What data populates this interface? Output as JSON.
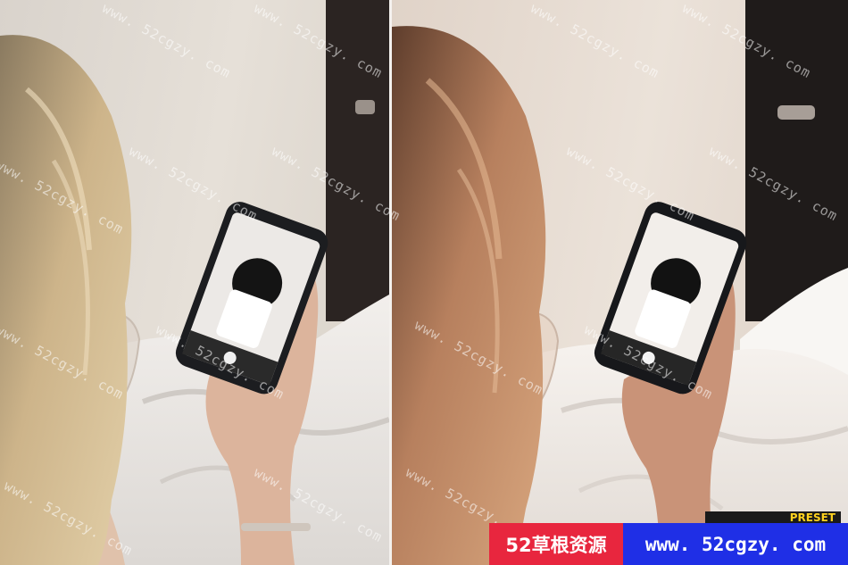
{
  "watermark": {
    "text": "www. 52cgzy. com"
  },
  "banner": {
    "site_name": "52草根资源",
    "site_url": "www. 52cgzy. com",
    "left_color": "#e8263e",
    "right_color": "#1f2fe6"
  },
  "preset_tag": {
    "text": "PRESET"
  },
  "panels": {
    "left_label": "",
    "right_label": ""
  }
}
